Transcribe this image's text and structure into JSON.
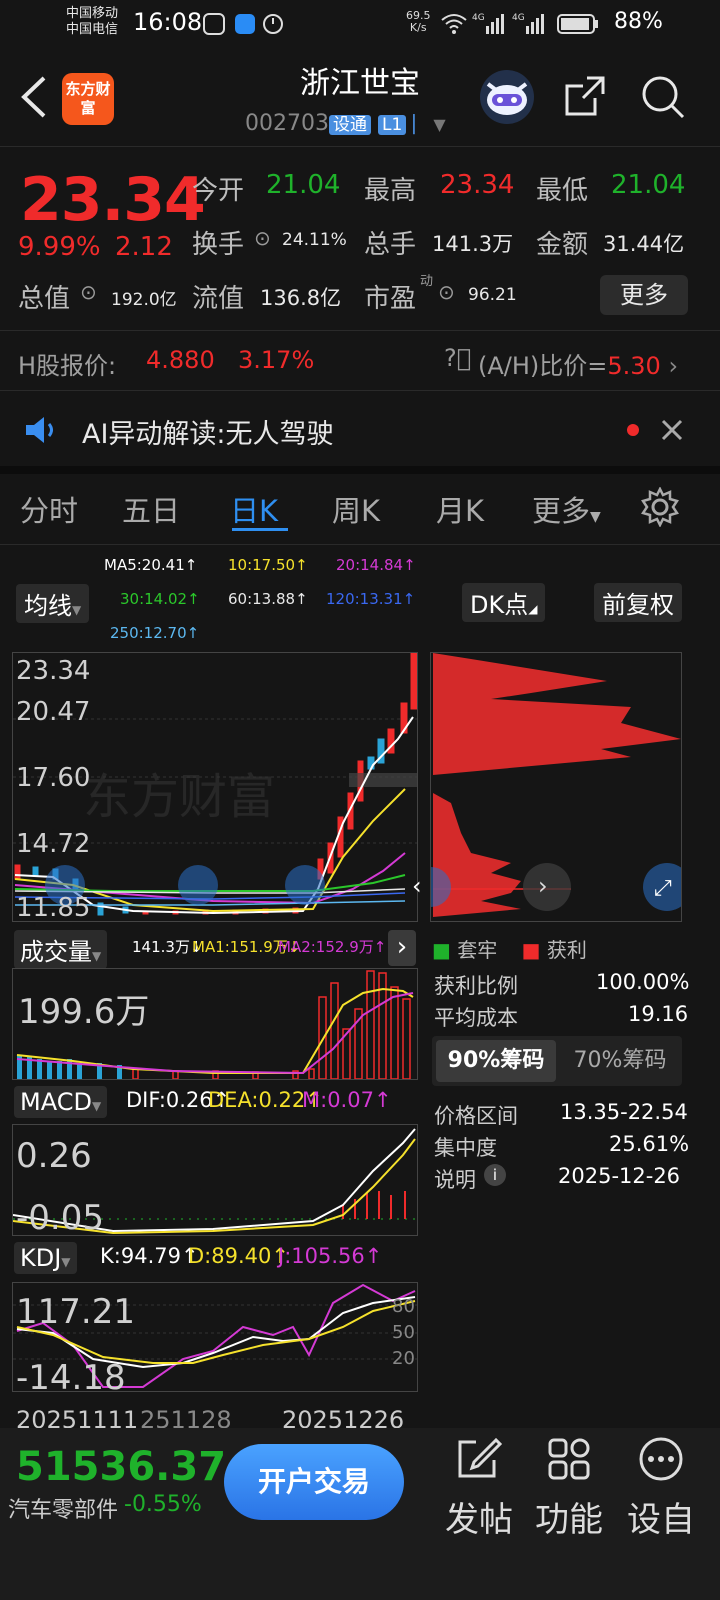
{
  "status": {
    "carrier1": "中国移动",
    "carrier2": "中国电信",
    "time": "16:08",
    "net_speed": "69.5",
    "net_unit": "K/s",
    "battery": "88%"
  },
  "header": {
    "logo": "东方财富",
    "title": "浙江世宝",
    "code": "002703",
    "tag1": "设通",
    "tag2": "L1"
  },
  "quote": {
    "price": "23.34",
    "change_pct": "9.99%",
    "change": "2.12",
    "open_label": "今开",
    "open": "21.04",
    "high_label": "最高",
    "high": "23.34",
    "low_label": "最低",
    "low": "21.04",
    "turnover_label": "换手",
    "turnover": "24.11%",
    "volume_label": "总手",
    "volume": "141.3万",
    "amount_label": "金额",
    "amount": "31.44亿",
    "mktcap_label": "总值",
    "mktcap": "192.0亿",
    "float_label": "流值",
    "float": "136.8亿",
    "pe_label": "市盈",
    "pe_sup": "动",
    "pe": "96.21",
    "more": "更多"
  },
  "hshare": {
    "label": "H股报价:",
    "price": "4.880",
    "pct": "3.17%",
    "ratio_label": "(A/H)比价=",
    "ratio": "5.30"
  },
  "ai": {
    "label": "AI异动解读:",
    "topic": "无人驾驶"
  },
  "tabs": [
    "分时",
    "五日",
    "日K",
    "周K",
    "月K",
    "更多"
  ],
  "chart": {
    "ma_chip": "均线",
    "ma5": "MA5:20.41↑",
    "ma10": "10:17.50↑",
    "ma20": "20:14.84↑",
    "ma30": "30:14.02↑",
    "ma60": "60:13.88↑",
    "ma120": "120:13.31↑",
    "ma250": "250:12.70↑",
    "dk_chip": "DK点",
    "adj_chip": "前复权",
    "price_ticks": [
      "23.34",
      "20.47",
      "17.60",
      "14.72",
      "11.85"
    ],
    "watermark": "东方财富",
    "vol_chip": "成交量",
    "vol_now": "141.3万↓",
    "vol_ma1": "MA1:151.9万↓",
    "vol_ma2": "MA2:152.9万↑",
    "vol_max": "199.6万",
    "macd_chip": "MACD",
    "dif": "DIF:0.26↑",
    "dea": "DEA:0.22↑",
    "m": "M:0.07↑",
    "macd_top": "0.26",
    "macd_bottom": "-0.05",
    "kdj_chip": "KDJ",
    "k": "K:94.79↑",
    "d": "D:89.40↑",
    "j": "J:105.56↑",
    "kdj_top": "117.21",
    "kdj_bottom": "-14.18",
    "kdj_levels": [
      "80",
      "50",
      "20"
    ],
    "dates": "20251111",
    "date_mid": "251128",
    "date_end": "20251226"
  },
  "chips": {
    "legend_trapped": "套牢",
    "legend_profit": "获利",
    "profit_ratio_label": "获利比例",
    "profit_ratio": "100.00%",
    "avg_cost_label": "平均成本",
    "avg_cost": "19.16",
    "tab90": "90%筹码",
    "tab70": "70%筹码",
    "range_label": "价格区间",
    "range": "13.35-22.54",
    "conc_label": "集中度",
    "conc": "25.61%",
    "note_label": "说明",
    "note": "2025-12-26"
  },
  "colors": {
    "up": "#f02b2b",
    "down": "#1fb22b",
    "accent": "#2f8ff0"
  },
  "bottom": {
    "index_value": "51536.37",
    "index_name": "汽车零部件",
    "index_pct": "-0.55%",
    "open_account": "开户交易",
    "post": "发帖",
    "functions": "功能",
    "custom": "设自"
  }
}
